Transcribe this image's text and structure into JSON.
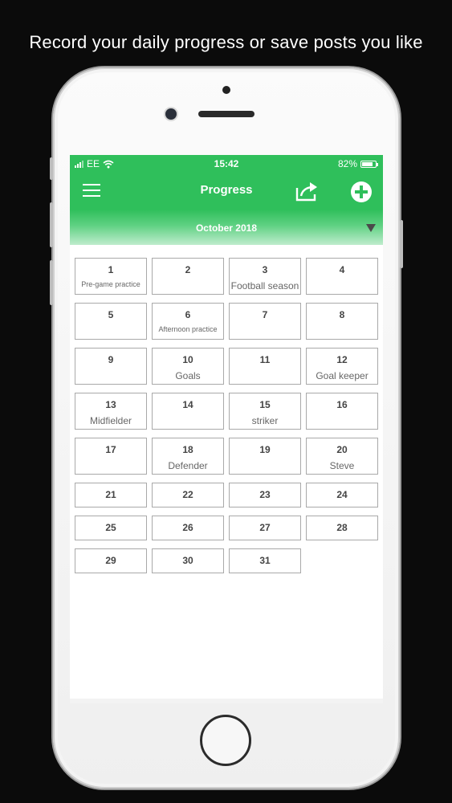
{
  "caption": "Record your daily progress or save posts you like",
  "status": {
    "carrier": "EE",
    "time": "15:42",
    "battery": "82%",
    "battery_level": 0.82
  },
  "nav": {
    "title": "Progress",
    "menu_icon": "hamburger-icon",
    "share_icon": "share-icon",
    "add_icon": "plus-circle-icon"
  },
  "month": {
    "label": "October 2018",
    "caret_icon": "caret-down-icon"
  },
  "colors": {
    "accent": "#2fbf5b",
    "background": "#0b0b0b"
  },
  "days": [
    {
      "num": "1",
      "note": "Pre-game practice"
    },
    {
      "num": "2",
      "note": ""
    },
    {
      "num": "3",
      "note": "Football season"
    },
    {
      "num": "4",
      "note": ""
    },
    {
      "num": "5",
      "note": ""
    },
    {
      "num": "6",
      "note": "Afternoon practice"
    },
    {
      "num": "7",
      "note": ""
    },
    {
      "num": "8",
      "note": ""
    },
    {
      "num": "9",
      "note": ""
    },
    {
      "num": "10",
      "note": "Goals"
    },
    {
      "num": "11",
      "note": ""
    },
    {
      "num": "12",
      "note": "Goal keeper"
    },
    {
      "num": "13",
      "note": "Midfielder"
    },
    {
      "num": "14",
      "note": ""
    },
    {
      "num": "15",
      "note": "striker"
    },
    {
      "num": "16",
      "note": ""
    },
    {
      "num": "17",
      "note": ""
    },
    {
      "num": "18",
      "note": "Defender"
    },
    {
      "num": "19",
      "note": ""
    },
    {
      "num": "20",
      "note": "Steve"
    },
    {
      "num": "21",
      "note": ""
    },
    {
      "num": "22",
      "note": ""
    },
    {
      "num": "23",
      "note": ""
    },
    {
      "num": "24",
      "note": ""
    },
    {
      "num": "25",
      "note": ""
    },
    {
      "num": "26",
      "note": ""
    },
    {
      "num": "27",
      "note": ""
    },
    {
      "num": "28",
      "note": ""
    },
    {
      "num": "29",
      "note": ""
    },
    {
      "num": "30",
      "note": ""
    },
    {
      "num": "31",
      "note": ""
    }
  ]
}
